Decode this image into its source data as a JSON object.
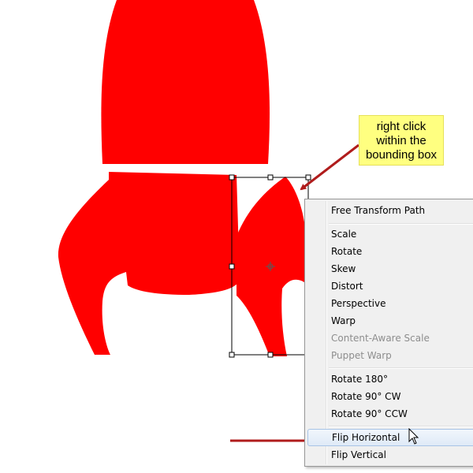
{
  "callout": {
    "line1": "right click",
    "line2": "within the",
    "line3": "bounding box"
  },
  "colors": {
    "shape_fill": "#ff0000",
    "arrow": "#b01c1c",
    "callout_bg": "#ffff80",
    "menu_bg": "#f0f0f0"
  },
  "context_menu": {
    "items": [
      {
        "label": "Free Transform Path",
        "enabled": true
      },
      {
        "label": "Scale",
        "enabled": true
      },
      {
        "label": "Rotate",
        "enabled": true
      },
      {
        "label": "Skew",
        "enabled": true
      },
      {
        "label": "Distort",
        "enabled": true
      },
      {
        "label": "Perspective",
        "enabled": true
      },
      {
        "label": "Warp",
        "enabled": true
      },
      {
        "label": "Content-Aware Scale",
        "enabled": false
      },
      {
        "label": "Puppet Warp",
        "enabled": false
      },
      {
        "label": "Rotate 180°",
        "enabled": true
      },
      {
        "label": "Rotate 90° CW",
        "enabled": true
      },
      {
        "label": "Rotate 90° CCW",
        "enabled": true
      },
      {
        "label": "Flip Horizontal",
        "enabled": true,
        "highlighted": true
      },
      {
        "label": "Flip Vertical",
        "enabled": true
      }
    ]
  }
}
